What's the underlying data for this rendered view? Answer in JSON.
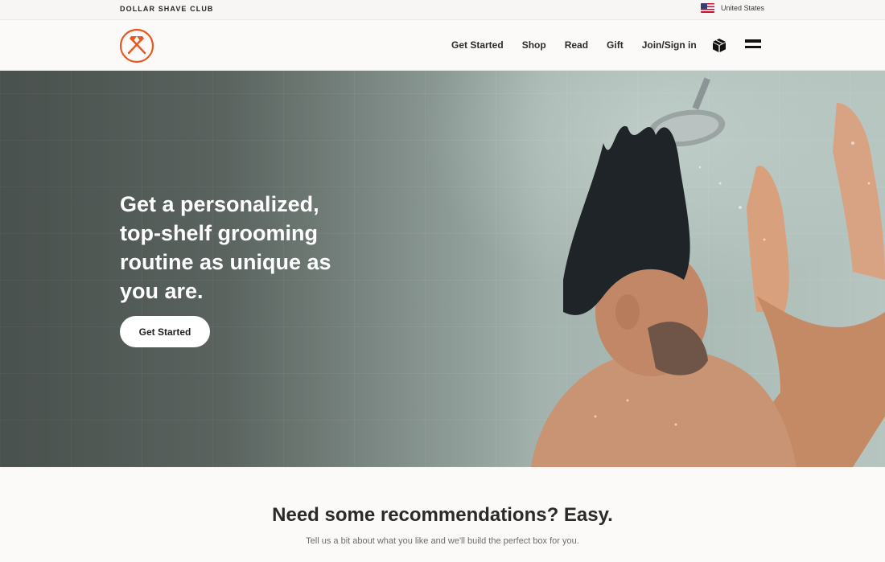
{
  "utility_bar": {
    "brand": "DOLLAR SHAVE CLUB",
    "locale": "United States"
  },
  "nav": {
    "links": [
      "Get Started",
      "Shop",
      "Read",
      "Gift",
      "Join/Sign in"
    ],
    "icons": [
      "logo-hammers-icon",
      "box-icon",
      "menu-icon"
    ]
  },
  "hero": {
    "headline": "Get a personalized, top-shelf grooming routine as unique as you are.",
    "cta_label": "Get Started"
  },
  "recommendations": {
    "title": "Need some recommendations? Easy.",
    "subtitle": "Tell us a bit about what you like and we'll build the perfect box for you."
  },
  "colors": {
    "brand_orange": "#e8571f",
    "text_dark": "#2b2a29",
    "hero_overlay": "#5b6460"
  }
}
